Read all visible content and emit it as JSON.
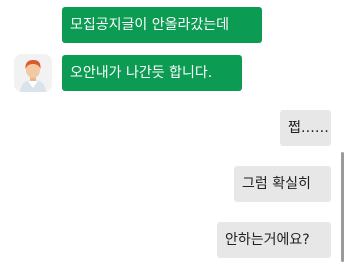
{
  "conversation": {
    "incoming": [
      {
        "text": "모집공지글이 안올라갔는데"
      },
      {
        "text": "오안내가 나간듯 합니다."
      }
    ],
    "outgoing": [
      {
        "text": "쩝……"
      },
      {
        "text": "그럼 확실히"
      },
      {
        "text": "안하는거에요?"
      }
    ]
  },
  "avatar": {
    "icon": "user-avatar-icon"
  },
  "colors": {
    "incoming_bubble": "#0b9b52",
    "outgoing_bubble": "#e7e7e7"
  }
}
